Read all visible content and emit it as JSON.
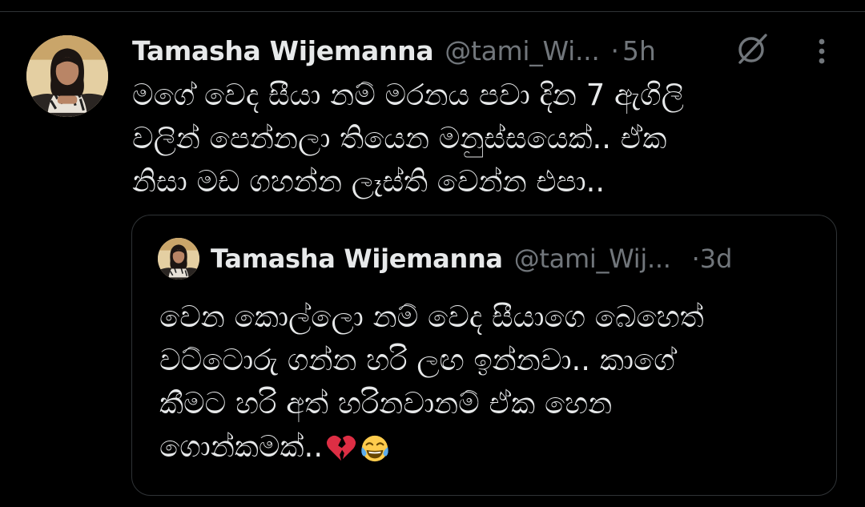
{
  "tweet": {
    "author": {
      "display_name": "Tamasha Wijemanna",
      "handle": "@tami_Wi...",
      "avatar_icon": "profile-photo"
    },
    "separator": "·",
    "time": "5h",
    "text_lines": [
      "මගේ වෙද සීයා නම් මරනය පවා දින 7 ඇගිලි",
      "වලින් පෙන්නලා තියෙන මනුස්සයෙක්.. ඒක",
      "නිසා මඩ ගහන්න ලෑස්ති වෙන්න එපා.."
    ],
    "grok_icon": "grok-icon",
    "more_icon": "more-vertical-icon"
  },
  "quoted_tweet": {
    "author": {
      "display_name": "Tamasha Wijemanna",
      "handle": "@tami_Wij...",
      "avatar_icon": "profile-photo"
    },
    "separator": "·",
    "time": "3d",
    "text_lines": [
      "වෙන කොල්ලො නම් වෙද සීයාගෙ බෙහෙත්",
      "වට්ටොරු ගන්න හරි ලඟ ඉන්නවා.. කාගේ",
      "කීමට හරි අත් හරිනවානම් ඒක හෙන",
      "ගොන්කමක්.."
    ],
    "emojis": [
      "broken-heart-emoji",
      "tears-of-joy-emoji"
    ]
  },
  "colors": {
    "background": "#000000",
    "primary_text": "#e7e9ea",
    "secondary_text": "#71767b",
    "border": "#2f3336"
  }
}
